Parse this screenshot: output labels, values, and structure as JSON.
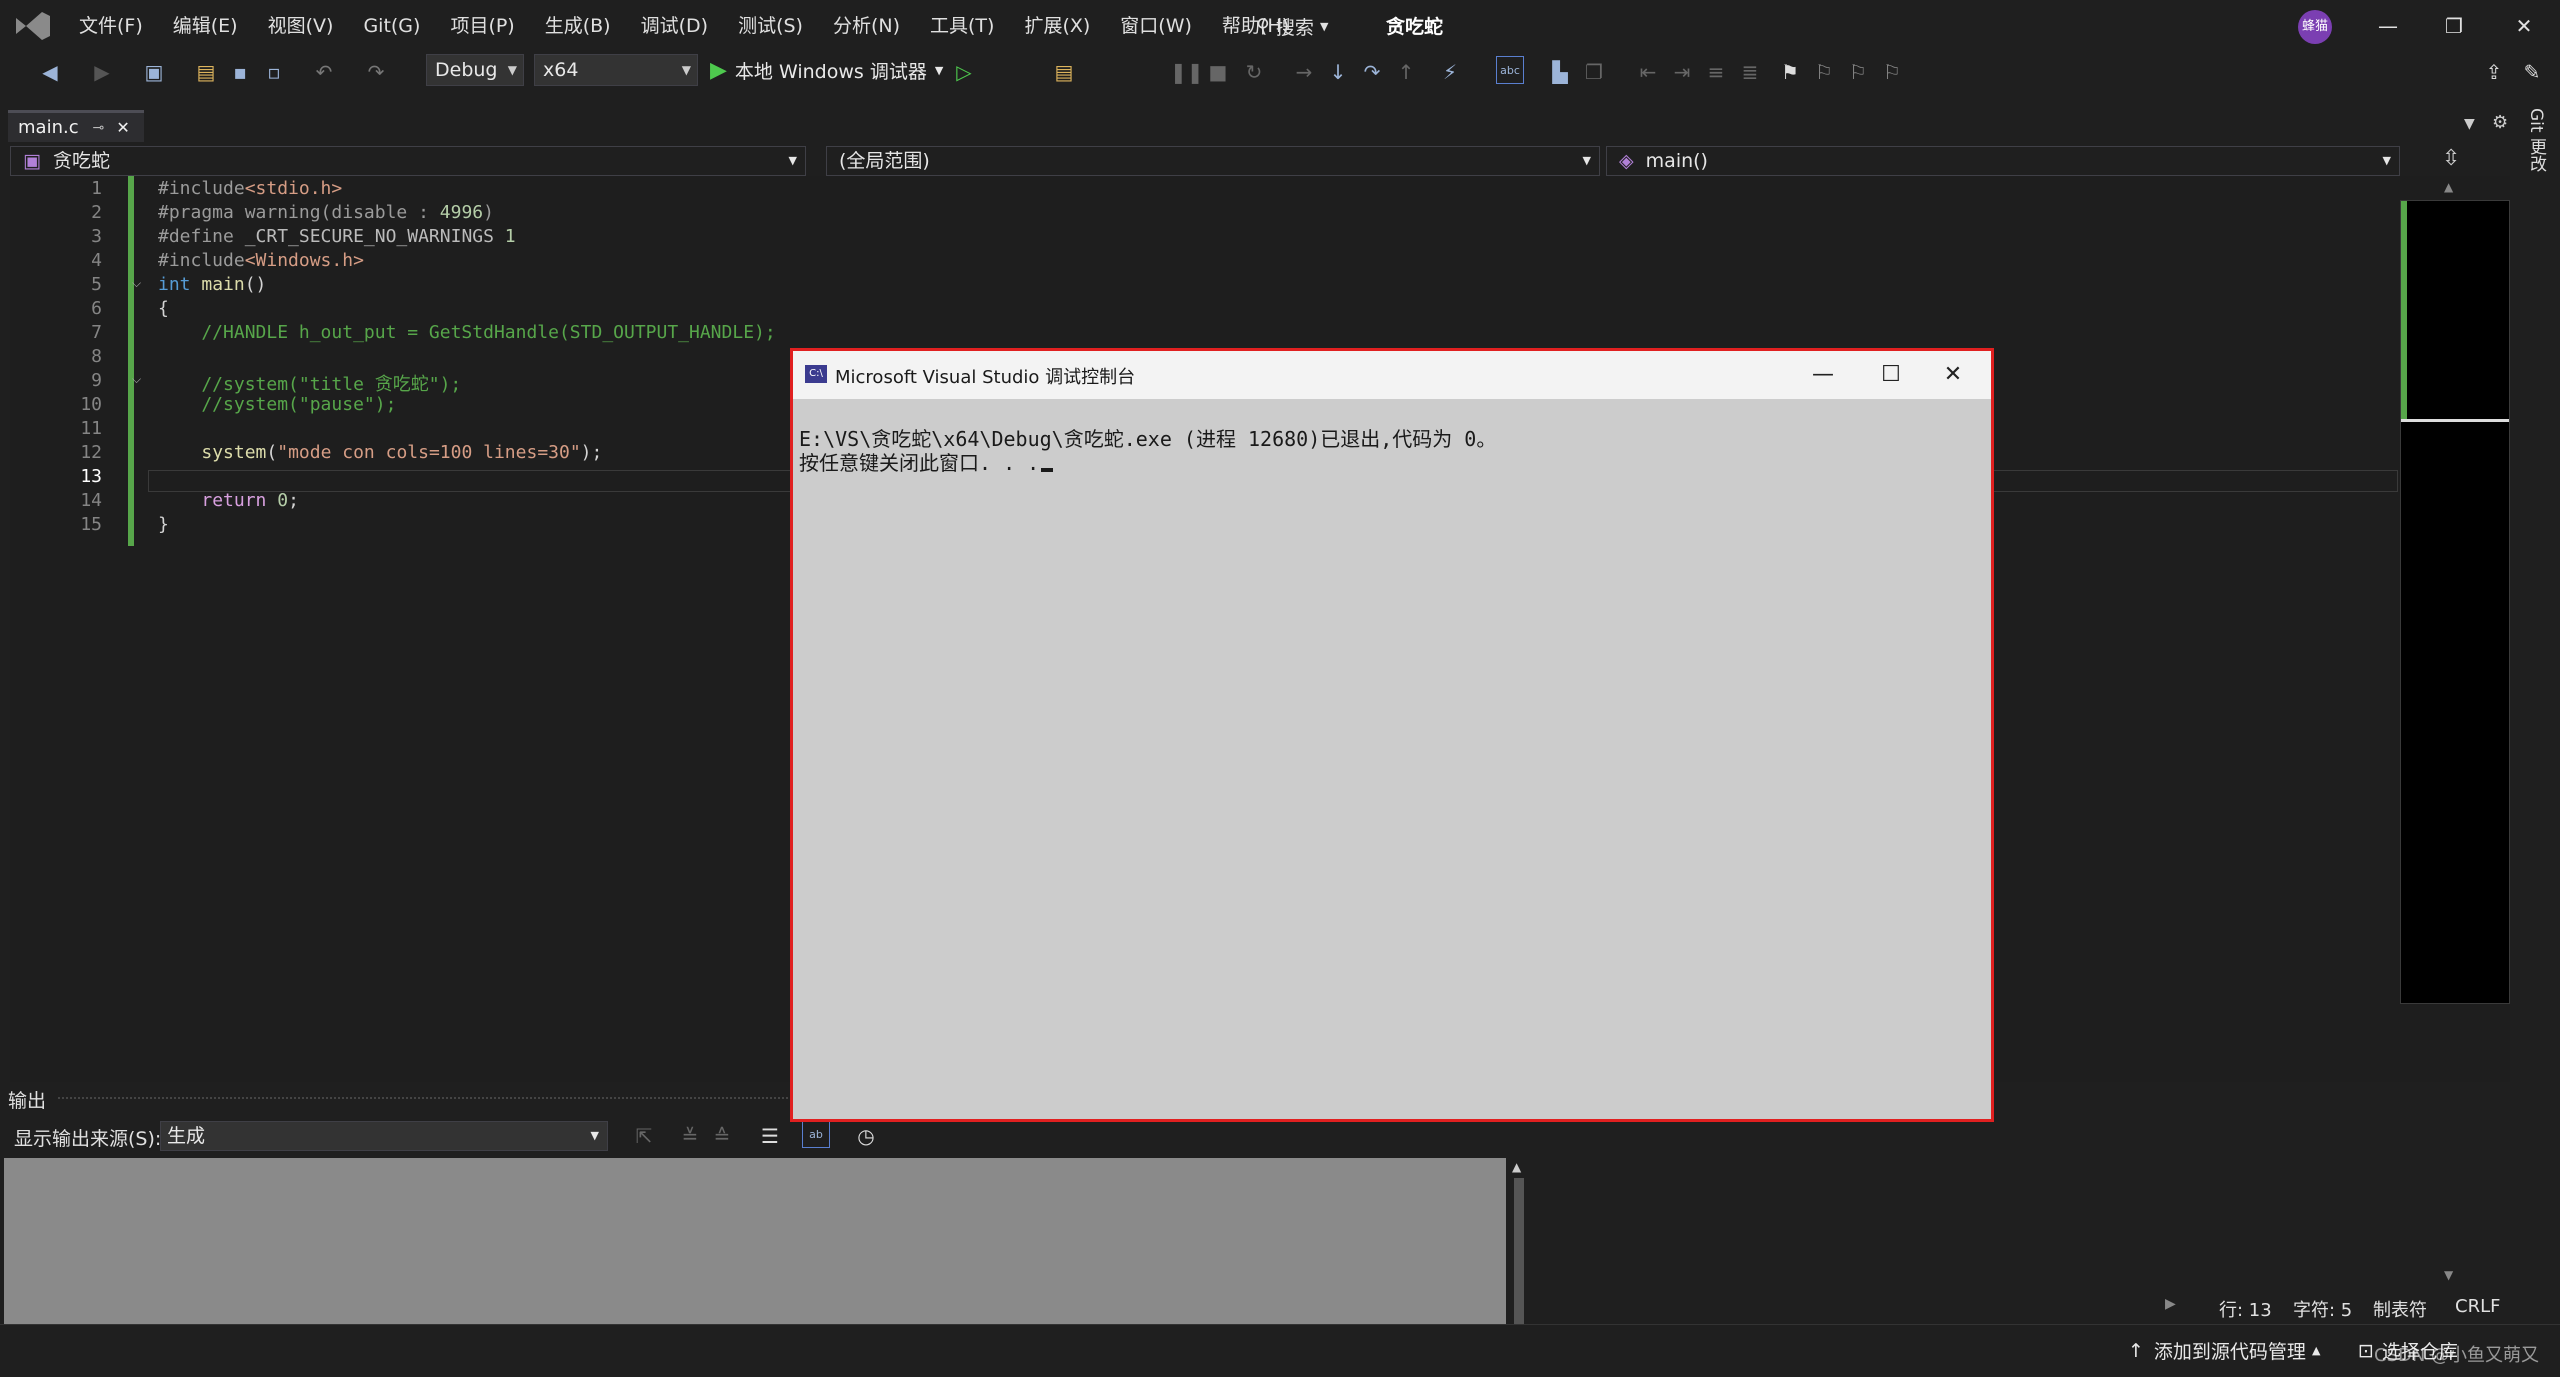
{
  "menubar": {
    "items": [
      "文件(F)",
      "编辑(E)",
      "视图(V)",
      "Git(G)",
      "项目(P)",
      "生成(B)",
      "调试(D)",
      "测试(S)",
      "分析(N)",
      "工具(T)",
      "扩展(X)",
      "窗口(W)",
      "帮助(H)"
    ],
    "search_label": "搜索",
    "solution_title": "贪吃蛇",
    "avatar_text": "蜂猫",
    "window_buttons": [
      "—",
      "❐",
      "✕"
    ]
  },
  "toolbar": {
    "config": "Debug",
    "platform": "x64",
    "run_label": "本地 Windows 调试器"
  },
  "tabs": [
    {
      "label": "main.c",
      "pin": "⊸",
      "close": "✕"
    }
  ],
  "navbar": {
    "project": "贪吃蛇",
    "scope": "(全局范围)",
    "member": "main()"
  },
  "editor": {
    "current_line": 13,
    "line_numbers": [
      "1",
      "2",
      "3",
      "4",
      "5",
      "6",
      "7",
      "8",
      "9",
      "10",
      "11",
      "12",
      "13",
      "14",
      "15"
    ]
  },
  "right_strip": {
    "git_label": "Git 更改"
  },
  "output": {
    "title": "输出",
    "source_label": "显示输出来源(S):",
    "source_value": "生成"
  },
  "status": {
    "line": "行: 13",
    "char": "字符: 5",
    "tabs": "制表符",
    "eol": "CRLF"
  },
  "bottom": {
    "source_control": "添加到源代码管理",
    "repo": "选择仓库",
    "watermark": "CSDN @小鱼又萌又"
  },
  "console": {
    "title": "Microsoft Visual Studio 调试控制台",
    "icon_text": "C:\\",
    "line1": "E:\\VS\\贪吃蛇\\x64\\Debug\\贪吃蛇.exe (进程 12680)已退出,代码为 0。",
    "line2": "按任意键关闭此窗口. . .",
    "buttons": [
      "—",
      "☐",
      "✕"
    ]
  },
  "colors": {
    "accent": "#e02020",
    "gutter_change": "#57a64a",
    "console_bg": "#cccccc"
  }
}
